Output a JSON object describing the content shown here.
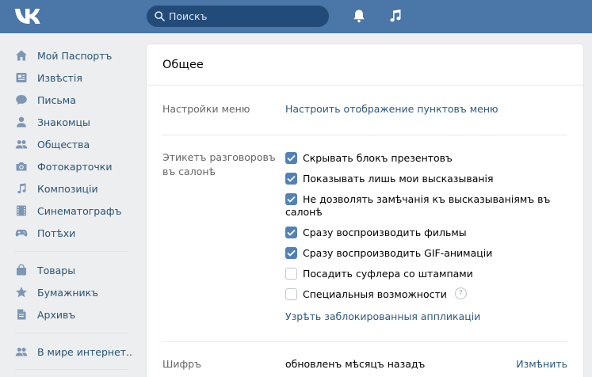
{
  "header": {
    "logo_text": "VK",
    "search_placeholder": "Поискъ",
    "icons": [
      "bell-icon",
      "music-note-icon"
    ]
  },
  "sidebar": {
    "items": [
      {
        "label": "Мой Паспортъ",
        "icon": "home-icon"
      },
      {
        "label": "Извѣстія",
        "icon": "news-icon"
      },
      {
        "label": "Письма",
        "icon": "chat-bubble-icon"
      },
      {
        "label": "Знакомцы",
        "icon": "person-icon"
      },
      {
        "label": "Общества",
        "icon": "group-icon"
      },
      {
        "label": "Фотокарточки",
        "icon": "camera-icon"
      },
      {
        "label": "Композиціи",
        "icon": "music-icon"
      },
      {
        "label": "Синематографъ",
        "icon": "film-icon"
      },
      {
        "label": "Потѣхи",
        "icon": "gamepad-icon"
      }
    ],
    "items2": [
      {
        "label": "Товары",
        "icon": "bag-icon"
      },
      {
        "label": "Бумажникъ",
        "icon": "star-icon"
      },
      {
        "label": "Архивъ",
        "icon": "document-icon"
      }
    ],
    "items3": [
      {
        "label": "В мире интернет..",
        "icon": "group-icon"
      }
    ]
  },
  "main": {
    "title": "Общее",
    "menu_settings": {
      "label": "Настройки меню",
      "link": "Настроить отображение пунктовъ меню"
    },
    "etiquette": {
      "label_line1": "Этикетъ разговоровъ",
      "label_line2": "въ салонѣ",
      "options": [
        {
          "text": "Скрывать блокъ презентовъ",
          "checked": true
        },
        {
          "text": "Показывать лишь мои высказыванія",
          "checked": true
        },
        {
          "text_line1": "Не дозволять замѣчанія къ высказываніямъ въ",
          "text_line2": "салонѣ",
          "checked": true
        },
        {
          "text": "Сразу воспроизводить фильмы",
          "checked": true
        },
        {
          "text": "Сразу воспроизводить GIF-анимаціи",
          "checked": true
        },
        {
          "text": "Посадить суфлера со штампами",
          "checked": false
        },
        {
          "text": "Специальныя возможности",
          "checked": false,
          "help": "?"
        }
      ],
      "blocked_link": "Узрѣть заблокированныя аппликаціи"
    },
    "cipher": {
      "label": "Шифръ",
      "value": "обновленъ мѣсяцъ назадъ",
      "action": "Измѣнить"
    }
  }
}
